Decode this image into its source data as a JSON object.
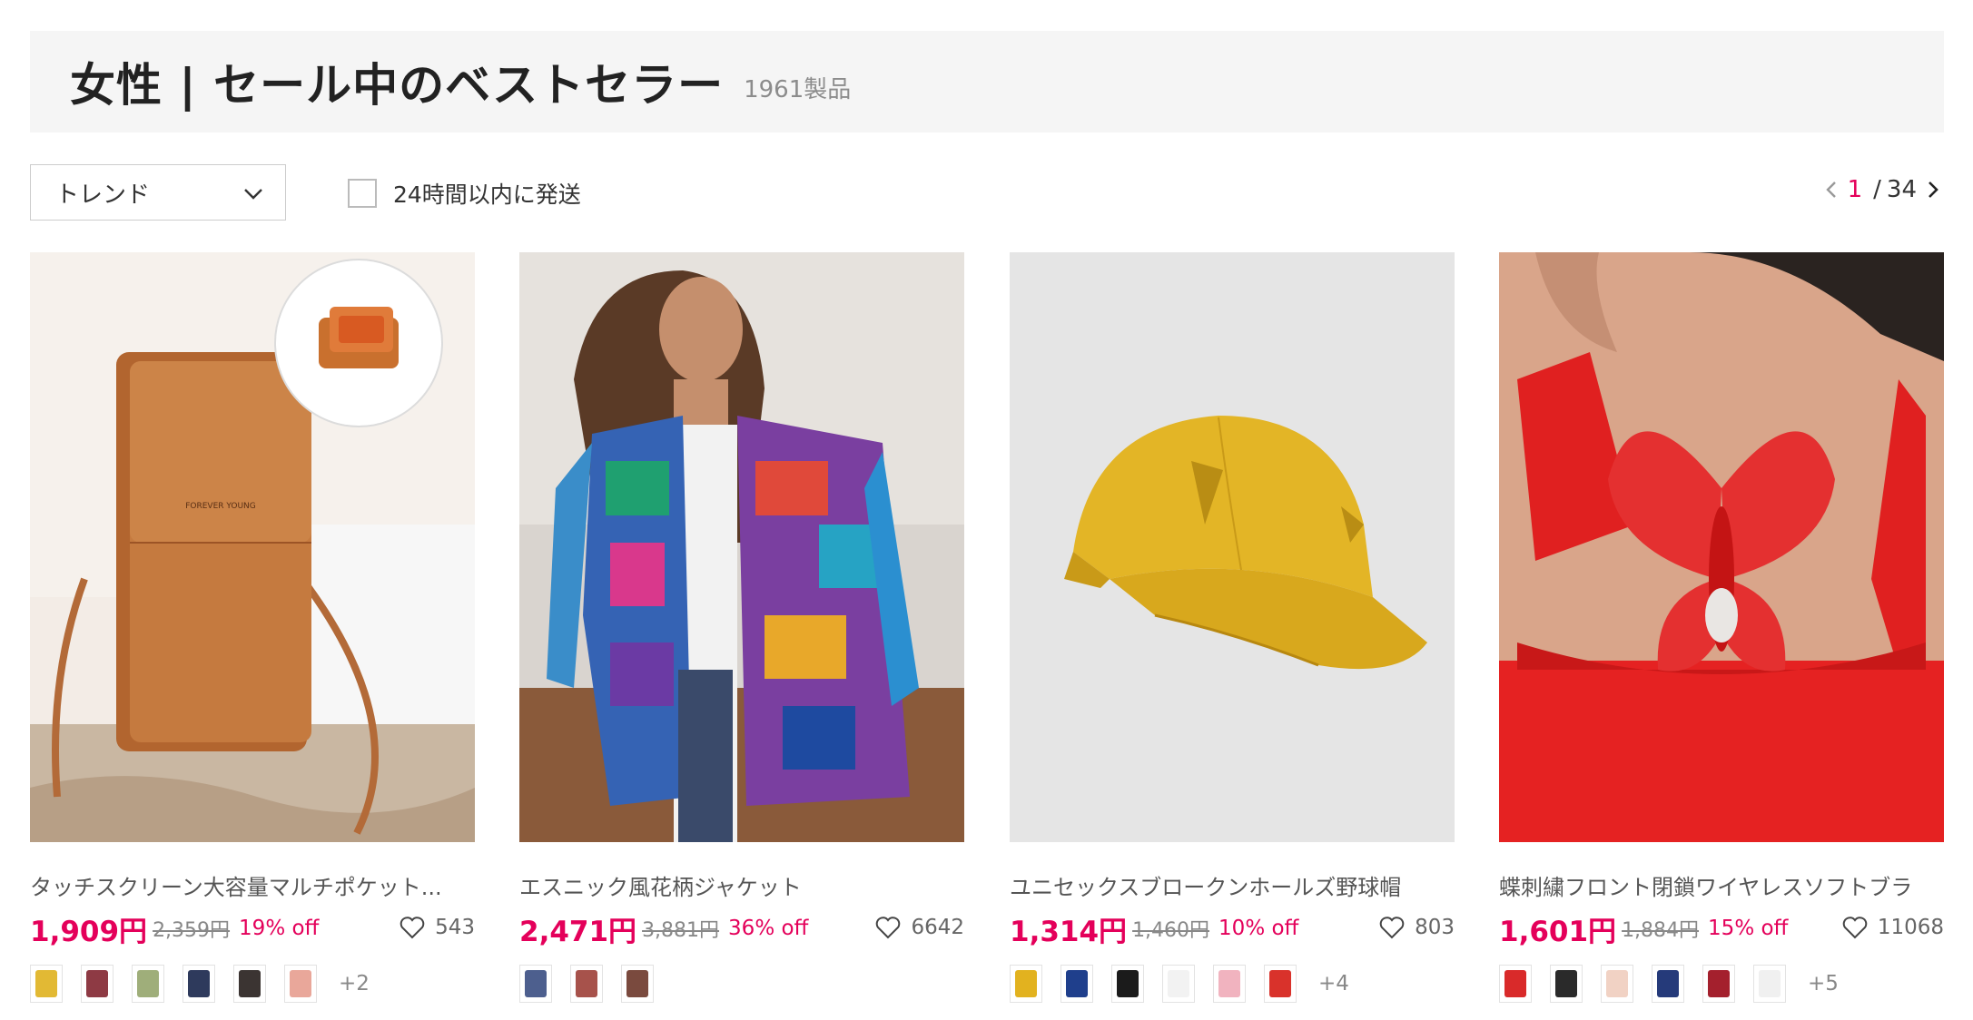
{
  "header": {
    "title": "女性 | セール中のベストセラー",
    "count": "1961製品"
  },
  "toolbar": {
    "sort_label": "トレンド",
    "ship_filter_label": "24時間以内に発送",
    "pager": {
      "current": "1",
      "separator": "/",
      "total": "34"
    }
  },
  "accent_color": "#e4005a",
  "products": [
    {
      "name": "タッチスクリーン大容量マルチポケット...",
      "price": "1,909円",
      "original_price": "2,359円",
      "discount": "19% off",
      "favorites": "543",
      "swatch_colors": [
        "#e2b934",
        "#8e3a44",
        "#9fae7a",
        "#2e3a5c",
        "#3b3432",
        "#e9a79a"
      ],
      "more": "+2"
    },
    {
      "name": "エスニック風花柄ジャケット",
      "price": "2,471円",
      "original_price": "3,881円",
      "discount": "36% off",
      "favorites": "6642",
      "swatch_colors": [
        "#4d5f8e",
        "#a7524b",
        "#7a4a3e"
      ],
      "more": ""
    },
    {
      "name": "ユニセックスブロークンホールズ野球帽",
      "price": "1,314円",
      "original_price": "1,460円",
      "discount": "10% off",
      "favorites": "803",
      "swatch_colors": [
        "#e2b21f",
        "#1f3f8c",
        "#1b1b1b",
        "#f2f2f2",
        "#f1b3bf",
        "#d9322b"
      ],
      "more": "+4"
    },
    {
      "name": "蝶刺繍フロント閉鎖ワイヤレスソフトブラ",
      "price": "1,601円",
      "original_price": "1,884円",
      "discount": "15% off",
      "favorites": "11068",
      "swatch_colors": [
        "#d92a2a",
        "#2a2a2a",
        "#f1d2c4",
        "#253a7a",
        "#a4202d",
        "#f0f0f0"
      ],
      "more": "+5"
    }
  ]
}
